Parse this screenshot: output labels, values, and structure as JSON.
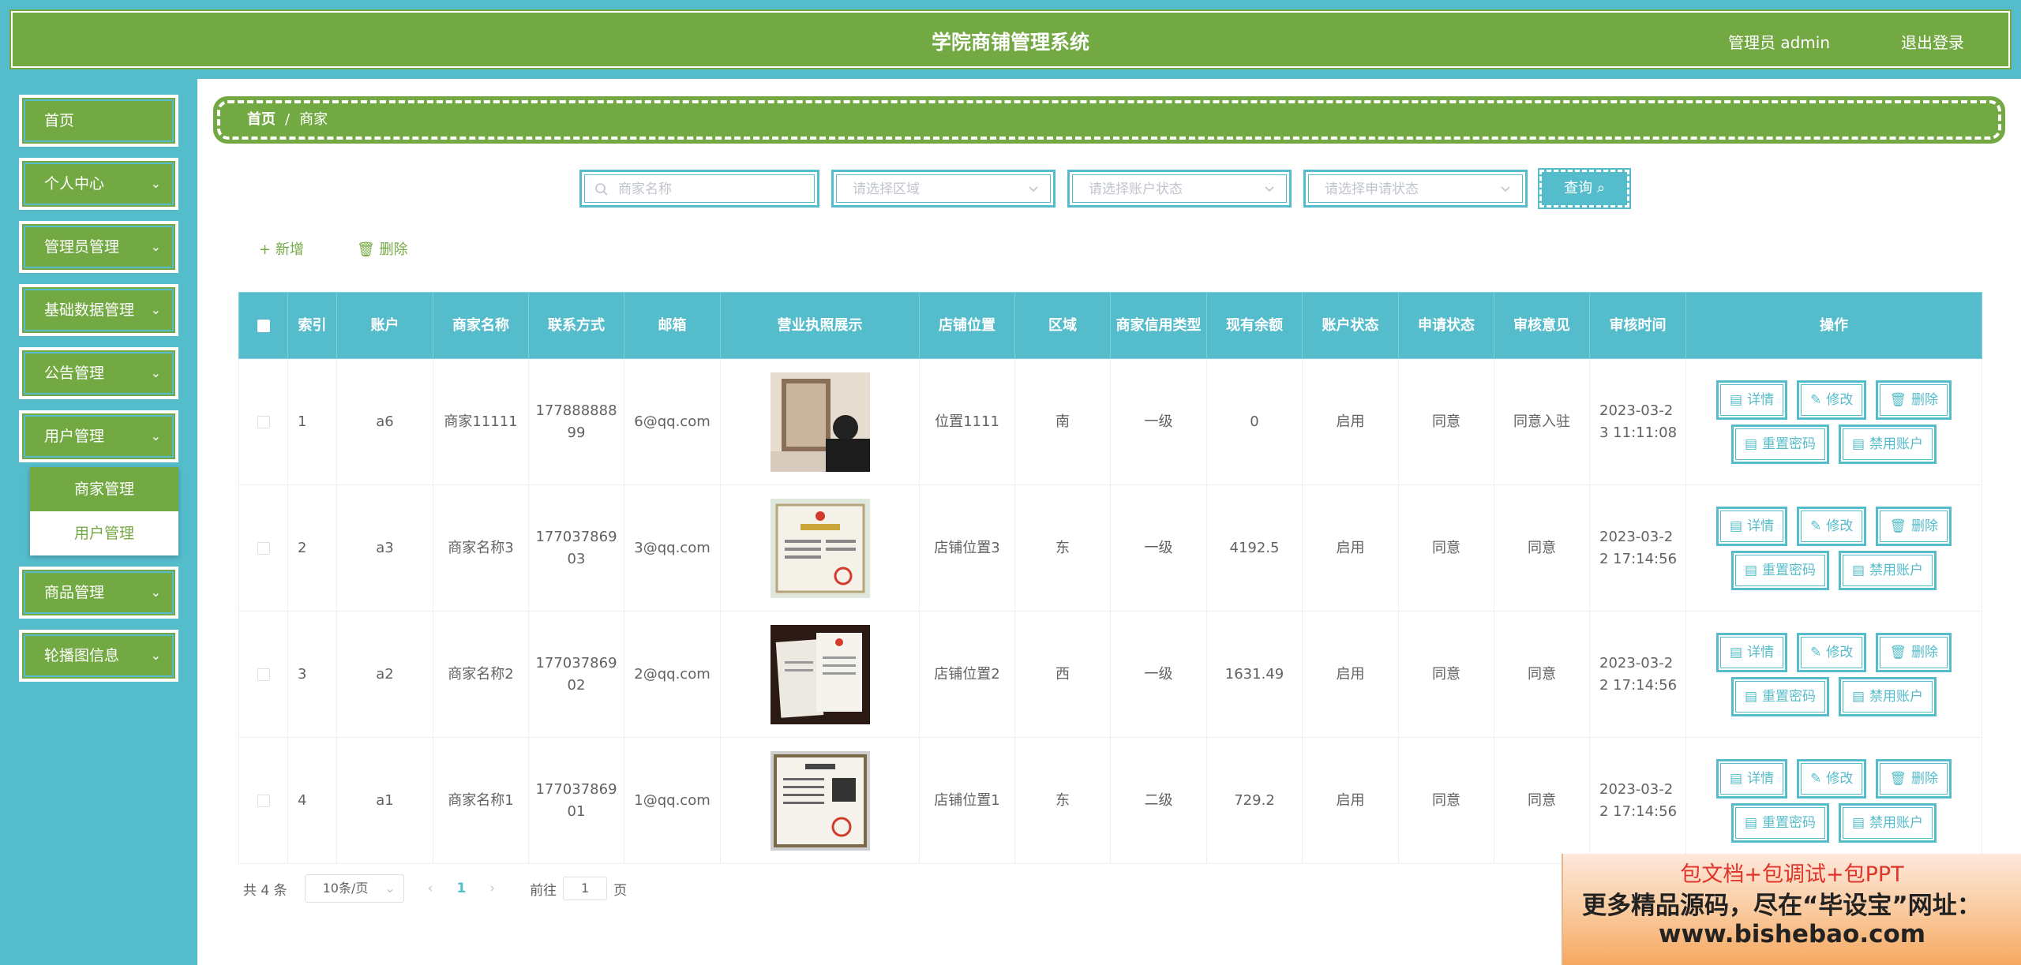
{
  "header": {
    "title": "学院商铺管理系统",
    "user": "管理员 admin",
    "logout": "退出登录"
  },
  "sidebar": {
    "items": [
      {
        "label": "首页"
      },
      {
        "label": "个人中心"
      },
      {
        "label": "管理员管理"
      },
      {
        "label": "基础数据管理"
      },
      {
        "label": "公告管理"
      },
      {
        "label": "用户管理"
      },
      {
        "label": "商品管理"
      },
      {
        "label": "轮播图信息"
      }
    ],
    "submenu": [
      {
        "label": "商家管理"
      },
      {
        "label": "用户管理"
      }
    ]
  },
  "breadcrumb": {
    "home": "首页",
    "sep": "/",
    "current": "商家"
  },
  "search": {
    "name_placeholder": "商家名称",
    "area_placeholder": "请选择区域",
    "account_status_placeholder": "请选择账户状态",
    "apply_status_placeholder": "请选择申请状态",
    "query_label": "查询"
  },
  "actions": {
    "add": "新增",
    "delete": "删除"
  },
  "table": {
    "headers": [
      "索引",
      "账户",
      "商家名称",
      "联系方式",
      "邮箱",
      "营业执照展示",
      "店铺位置",
      "区域",
      "商家信用类型",
      "现有余额",
      "账户状态",
      "申请状态",
      "审核意见",
      "审核时间",
      "操作"
    ],
    "rows": [
      {
        "index": "1",
        "account": "a6",
        "name": "商家11111",
        "phone": "17788888899",
        "email": "6@qq.com",
        "location": "位置1111",
        "area": "南",
        "credit": "一级",
        "balance": "0",
        "account_status": "启用",
        "apply_status": "同意",
        "opinion": "同意入驻",
        "time": "2023-03-23 11:11:08"
      },
      {
        "index": "2",
        "account": "a3",
        "name": "商家名称3",
        "phone": "17703786903",
        "email": "3@qq.com",
        "location": "店铺位置3",
        "area": "东",
        "credit": "一级",
        "balance": "4192.5",
        "account_status": "启用",
        "apply_status": "同意",
        "opinion": "同意",
        "time": "2023-03-22 17:14:56"
      },
      {
        "index": "3",
        "account": "a2",
        "name": "商家名称2",
        "phone": "17703786902",
        "email": "2@qq.com",
        "location": "店铺位置2",
        "area": "西",
        "credit": "一级",
        "balance": "1631.49",
        "account_status": "启用",
        "apply_status": "同意",
        "opinion": "同意",
        "time": "2023-03-22 17:14:56"
      },
      {
        "index": "4",
        "account": "a1",
        "name": "商家名称1",
        "phone": "17703786901",
        "email": "1@qq.com",
        "location": "店铺位置1",
        "area": "东",
        "credit": "二级",
        "balance": "729.2",
        "account_status": "启用",
        "apply_status": "同意",
        "opinion": "同意",
        "time": "2023-03-22 17:14:56"
      }
    ],
    "ops": {
      "detail": "详情",
      "edit": "修改",
      "delete": "删除",
      "reset_password": "重置密码",
      "disable_account": "禁用账户"
    }
  },
  "pagination": {
    "total": "共 4 条",
    "page_size": "10条/页",
    "current_page": "1",
    "goto_label": "前往",
    "goto_value": "1",
    "page_unit": "页"
  },
  "ad": {
    "line1": "包文档+包调试+包PPT",
    "line2": "更多精品源码，尽在“毕设宝”网址：",
    "line3": "www.bishebao.com"
  },
  "colors": {
    "primary_green": "#73a942",
    "accent_teal": "#55bccb"
  }
}
